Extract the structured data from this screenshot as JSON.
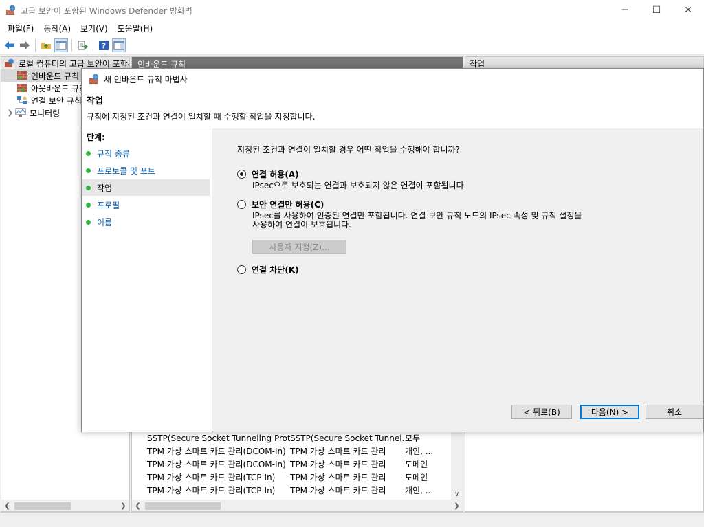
{
  "window": {
    "title": "고급 보안이 포함된 Windows Defender 방화벽",
    "minimize": "─",
    "maximize": "☐",
    "close": "✕"
  },
  "menu": [
    "파일(F)",
    "동작(A)",
    "보기(V)",
    "도움말(H)"
  ],
  "toolbar": {
    "icons": [
      "back-arrow-icon",
      "forward-arrow-icon",
      "up-folder-icon",
      "show-hide-tree-icon",
      "export-list-icon",
      "help-icon",
      "show-hide-action-pane-icon"
    ]
  },
  "tree": {
    "root": "로컬 컴퓨터의 고급 보안이 포함된 Windows Defender 방화벽",
    "items": [
      {
        "label": "인바운드 규칙",
        "selected": true
      },
      {
        "label": "아웃바운드 규칙",
        "selected": false
      },
      {
        "label": "연결 보안 규칙",
        "selected": false
      },
      {
        "label": "모니터링",
        "selected": false
      }
    ]
  },
  "center": {
    "header": "인바운드 규칙",
    "rows": [
      {
        "name": "SSTP(Secure Socket Tunneling Protocol)...",
        "group": "SSTP(Secure Socket Tunnel...",
        "profile": "모두"
      },
      {
        "name": "TPM 가상 스마트 카드 관리(DCOM-In)",
        "group": "TPM 가상 스마트 카드 관리",
        "profile": "개인, ..."
      },
      {
        "name": "TPM 가상 스마트 카드 관리(DCOM-In)",
        "group": "TPM 가상 스마트 카드 관리",
        "profile": "도메인"
      },
      {
        "name": "TPM 가상 스마트 카드 관리(TCP-In)",
        "group": "TPM 가상 스마트 카드 관리",
        "profile": "도메인"
      },
      {
        "name": "TPM 가상 스마트 카드 관리(TCP-In)",
        "group": "TPM 가상 스마트 카드 관리",
        "profile": "개인, ..."
      }
    ]
  },
  "right": {
    "header": "작업"
  },
  "wizard": {
    "title": "새 인바운드 규칙 마법사",
    "heading": "작업",
    "subheading": "규칙에 지정된 조건과 연결이 일치할 때 수행할 작업을 지정합니다.",
    "steps_label": "단계:",
    "steps": [
      {
        "label": "규칙 종류",
        "current": false
      },
      {
        "label": "프로토콜 및 포트",
        "current": false
      },
      {
        "label": "작업",
        "current": true
      },
      {
        "label": "프로필",
        "current": false
      },
      {
        "label": "이름",
        "current": false
      }
    ],
    "question": "지정된 조건과 연결이 일치할 경우 어떤 작업을 수행해야 합니까?",
    "options": {
      "allow": {
        "label": "연결 허용",
        "accel": "(A)",
        "checked": true,
        "desc": "IPsec으로 보호되는 연결과 보호되지 않은 연결이 포함됩니다."
      },
      "secure": {
        "label": "보안 연결만 허용",
        "accel": "(C)",
        "checked": false,
        "desc1": "IPsec를 사용하여 인증된 연결만 포함됩니다. 연결 보안 규칙 노드의 IPsec 속성 및 규칙 설정을",
        "desc2": "사용하여 연결이 보호됩니다."
      },
      "block": {
        "label": "연결 차단",
        "accel": "(K)",
        "checked": false
      }
    },
    "custom_button": "사용자 지정(Z)...",
    "back_button": "< 뒤로(B)",
    "next_button": "다음(N) >",
    "cancel_button": "취소"
  }
}
